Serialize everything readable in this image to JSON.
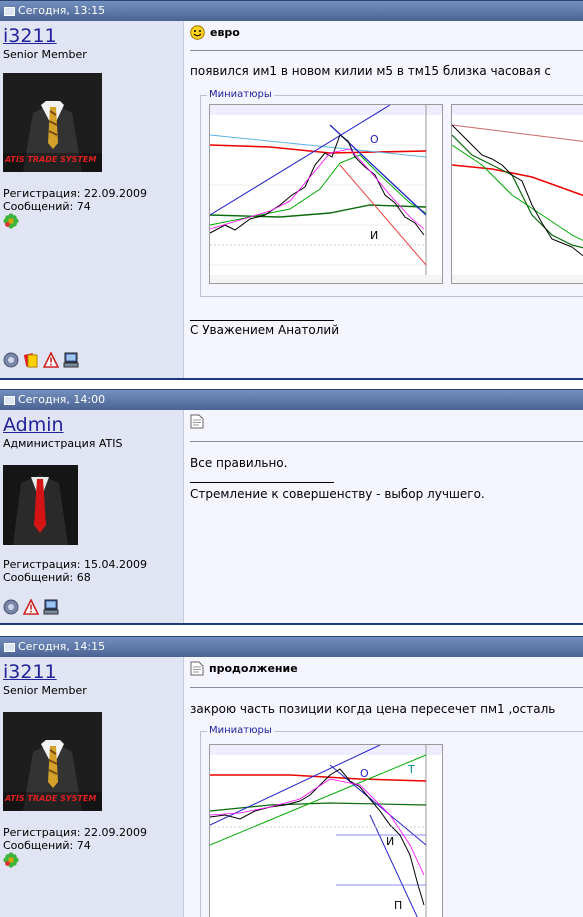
{
  "posts": [
    {
      "header_time": "Сегодня, 13:15",
      "username": "i3211",
      "user_title": "Senior Member",
      "avatar_logo": "ATIS TRADE SYSTEM",
      "registration": "Регистрация: 22.09.2009",
      "messages": "Сообщений: 74",
      "post_title": "евро",
      "post_icon": "smiley-icon",
      "body_text": "появился им1 в новом килии м5 в тм15 близка часовая с",
      "thumbnails_label": "Миниатюры",
      "signature": "С Уважением Анатолий",
      "chart_labels": [
        "О",
        "И"
      ]
    },
    {
      "header_time": "Сегодня, 14:00",
      "username": "Admin",
      "user_title": "Администрация ATIS",
      "registration": "Регистрация: 15.04.2009",
      "messages": "Сообщений: 68",
      "post_icon": "document-icon",
      "body_text": "Все правильно.",
      "signature": "Стремление к совершенству - выбор лучшего."
    },
    {
      "header_time": "Сегодня, 14:15",
      "username": "i3211",
      "user_title": "Senior Member",
      "avatar_logo": "ATIS TRADE SYSTEM",
      "registration": "Регистрация: 22.09.2009",
      "messages": "Сообщений: 74",
      "post_title": "продолжение",
      "post_icon": "document-icon",
      "body_text": "закрою часть позиции когда цена пересечет пм1 ,осталь",
      "thumbnails_label": "Миниатюры",
      "chart_labels": [
        "О",
        "Т",
        "И",
        "П"
      ]
    }
  ],
  "colors": {
    "header": "#5c7099",
    "sidebar": "#e1e4f2",
    "content": "#f5f5ff",
    "username": "#22229c"
  }
}
